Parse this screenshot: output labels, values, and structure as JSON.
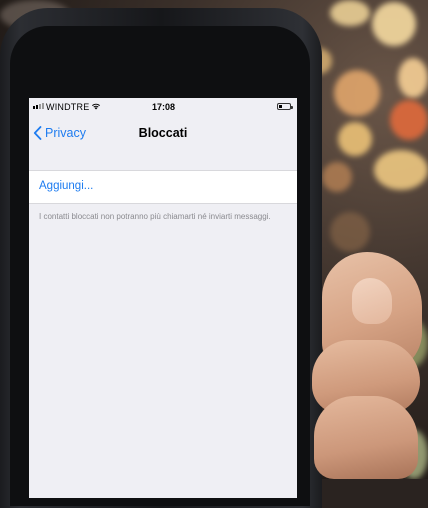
{
  "status_bar": {
    "carrier": "WINDTRE",
    "time": "17:08",
    "icons": [
      "signal-icon",
      "wifi-icon",
      "battery-icon"
    ]
  },
  "nav": {
    "back_label": "Privacy",
    "title": "Bloccati",
    "back_icon": "chevron-left-icon"
  },
  "list": {
    "add_label": "Aggiungi...",
    "footnote": "I contatti bloccati non potranno più chiamarti né inviarti messaggi."
  },
  "colors": {
    "accent": "#1e7cf0",
    "background": "#efeff4",
    "footnote_text": "#8a8a8f"
  }
}
